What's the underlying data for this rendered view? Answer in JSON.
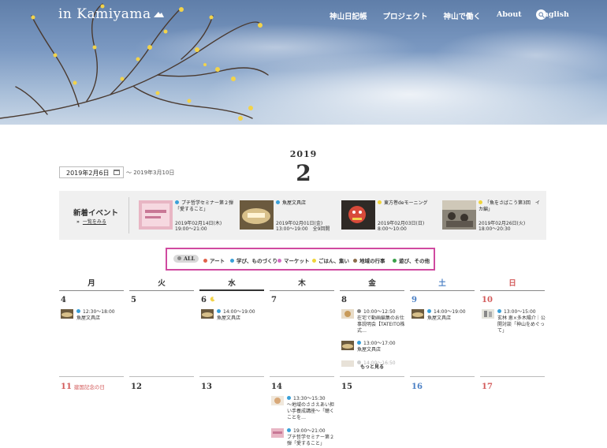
{
  "site": {
    "logo": "in Kamiyama"
  },
  "nav": {
    "items": [
      "神山日記帳",
      "プロジェクト",
      "神山で働く",
      "About",
      "English"
    ]
  },
  "calendar": {
    "year": "2019",
    "month": "2",
    "date_from": "2019年2月6日",
    "date_to": "～ 2019年3月10日"
  },
  "new_events": {
    "title": "新着イベント",
    "more_arrow": "»",
    "more_label": "一覧をみる",
    "items": [
      {
        "title": "プチ哲学セミナー第２弾「愛すること」",
        "date": "2019年02月14日(木)",
        "time": "19:00～21:00",
        "color": "#3aa0d8"
      },
      {
        "title": "魚屋文具店",
        "date": "2019年02月01日(金)",
        "time": "13:00～19:00　全9回開",
        "color": "#3aa0d8"
      },
      {
        "title": "東方巻deモーニング",
        "date": "2019年02月03日(日)",
        "time": "8:00～10:00",
        "color": "#f0d43a"
      },
      {
        "title": "「魚をさばこう第3回　イカ編」",
        "date": "2019年02月26日(火)",
        "time": "18:00～20:30",
        "color": "#f0d43a"
      }
    ]
  },
  "filters": [
    {
      "label": "ALL",
      "color": "#888888"
    },
    {
      "label": "アート",
      "color": "#e0614a"
    },
    {
      "label": "学び、ものづくり",
      "color": "#3aa0d8"
    },
    {
      "label": "マーケット",
      "color": "#d66cc4"
    },
    {
      "label": "ごはん、集い",
      "color": "#f0d43a"
    },
    {
      "label": "地域の行事",
      "color": "#8a6b4a"
    },
    {
      "label": "遊び、その他",
      "color": "#3aa04a"
    }
  ],
  "weekdays": [
    "月",
    "火",
    "水",
    "木",
    "金",
    "土",
    "日"
  ],
  "week1": {
    "days": [
      "4",
      "5",
      "6",
      "7",
      "8",
      "9",
      "10"
    ],
    "mon": {
      "time": "12:30～18:00",
      "title": "魚屋文具店"
    },
    "wed": {
      "time": "14:00～19:00",
      "title": "魚屋文具店"
    },
    "fri": [
      {
        "time": "10:00～12:50",
        "title": "在宅で動画編集のお仕事説明会【TATEITO株式…"
      },
      {
        "time": "13:00～17:00",
        "title": "魚屋文具店"
      },
      {
        "time": "14:00～16:50"
      }
    ],
    "fri_more": "もっと見る",
    "sat": {
      "time": "14:00～19:00",
      "title": "魚屋文具店"
    },
    "sun": {
      "time": "13:00～15:00",
      "title": "玄林 恵×多木陽介｜公開対談「神山をめぐって」"
    }
  },
  "week2": {
    "days": [
      "11",
      "12",
      "13",
      "14",
      "15",
      "16",
      "17"
    ],
    "holiday": "建国記念の日",
    "thu": [
      {
        "time": "13:30～15:30",
        "title": "〜地域のささえあい担い手養成講座〜「聴くことを…"
      },
      {
        "time": "19:00～21:00",
        "title": "プチ哲学セミナー第２弾「愛すること」"
      }
    ]
  }
}
